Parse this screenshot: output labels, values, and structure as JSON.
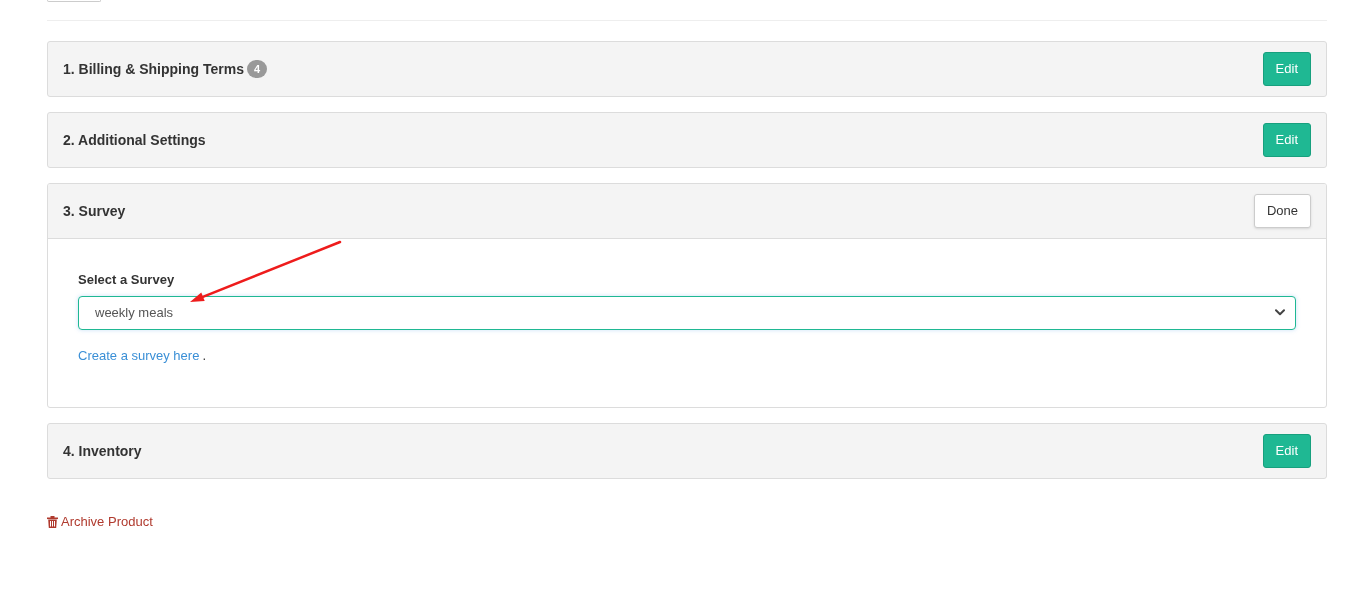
{
  "panels": [
    {
      "title": "1. Billing & Shipping Terms",
      "badge": "4",
      "expanded": false,
      "button": "Edit"
    },
    {
      "title": "2. Additional Settings",
      "expanded": false,
      "button": "Edit"
    },
    {
      "title": "3. Survey",
      "expanded": true,
      "button": "Done",
      "survey": {
        "label": "Select a Survey",
        "value": "weekly meals",
        "link": "Create a survey here",
        "link_suffix": "."
      }
    },
    {
      "title": "4. Inventory",
      "expanded": false,
      "button": "Edit"
    }
  ],
  "archive": {
    "label": "Archive Product"
  }
}
